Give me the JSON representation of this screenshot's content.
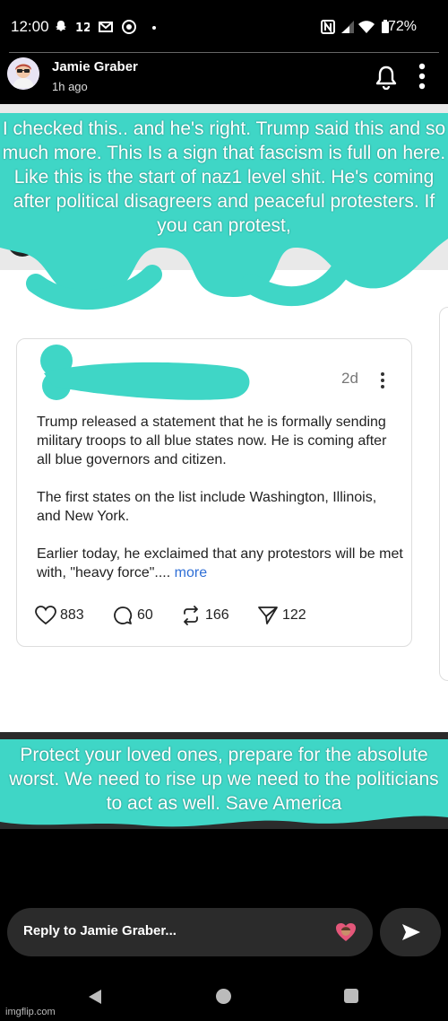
{
  "status_bar": {
    "time": "12:00",
    "icons": [
      "snapchat-icon",
      "settings-icon",
      "gmail-icon",
      "chrome-icon",
      "dot-icon",
      "nfc-icon",
      "signal-icon",
      "wifi-icon",
      "battery-icon"
    ],
    "battery_percent": "72%"
  },
  "story": {
    "user_name": "Jamie Graber",
    "time_ago": "1h ago"
  },
  "screenshot": {
    "top_caption": "I checked this.. and he's right. Trump said this and so much more. This Is a sign that fascism is full on here. Like this is the start of naz1 level shit. He's coming after political disagreers and peaceful protesters. If you can protest,",
    "post": {
      "time": "2d",
      "paragraph_1": "Trump released a statement that he is formally sending military troops to all blue states now. He is coming after all blue governors and citizen.",
      "paragraph_2": "The first states on the list include Washington, Illinois, and New York.",
      "paragraph_3": "Earlier today, he exclaimed that any protestors will be met with, \"heavy force\"....",
      "more_label": "more",
      "likes": "883",
      "replies": "60",
      "reposts": "166",
      "shares": "122"
    },
    "bottom_caption": "Protect your loved ones, prepare for the absolute worst. We need to rise up we need to the politicians to act as well. Save America"
  },
  "reply": {
    "placeholder": "Reply to Jamie Graber..."
  },
  "watermark": "imgflip.com",
  "colors": {
    "scribble": "#3fd6c6",
    "link": "#2f6fd6",
    "background": "#000000"
  }
}
